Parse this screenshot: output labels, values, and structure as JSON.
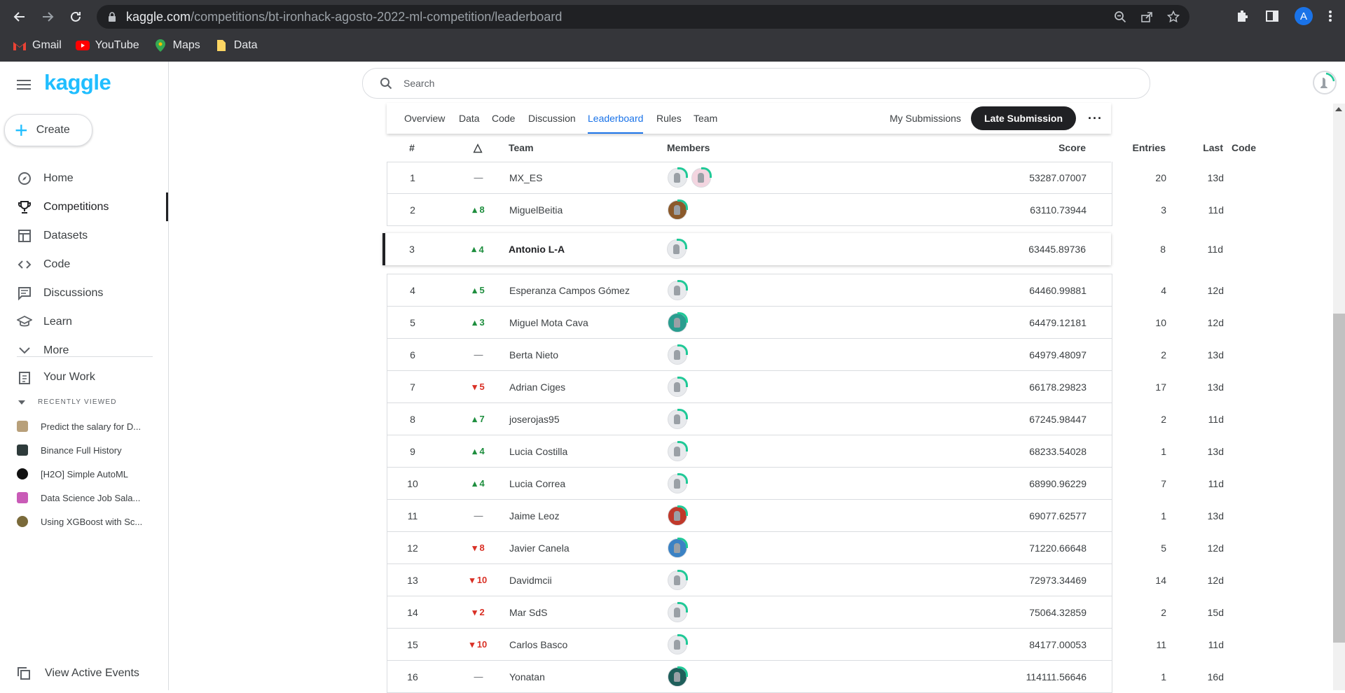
{
  "browser": {
    "url_domain": "kaggle.com",
    "url_path": "/competitions/bt-ironhack-agosto-2022-ml-competition/leaderboard",
    "profile_initial": "A",
    "bookmarks": [
      {
        "label": "Gmail",
        "icon": "gmail-icon"
      },
      {
        "label": "YouTube",
        "icon": "youtube-icon"
      },
      {
        "label": "Maps",
        "icon": "maps-icon"
      },
      {
        "label": "Data",
        "icon": "folder-icon"
      }
    ]
  },
  "sidebar": {
    "logo": "kaggle",
    "create_label": "Create",
    "items": [
      {
        "label": "Home",
        "icon": "compass-icon"
      },
      {
        "label": "Competitions",
        "icon": "trophy-icon",
        "active": true
      },
      {
        "label": "Datasets",
        "icon": "table-icon"
      },
      {
        "label": "Code",
        "icon": "code-icon"
      },
      {
        "label": "Discussions",
        "icon": "comment-icon"
      },
      {
        "label": "Learn",
        "icon": "school-icon"
      },
      {
        "label": "More",
        "icon": "chevron-down-icon"
      }
    ],
    "your_work": "Your Work",
    "recently_viewed_header": "RECENTLY VIEWED",
    "recent": [
      {
        "label": "Predict the salary for D..."
      },
      {
        "label": "Binance Full History"
      },
      {
        "label": "[H2O] Simple AutoML"
      },
      {
        "label": "Data Science Job Sala..."
      },
      {
        "label": "Using XGBoost with Sc..."
      }
    ],
    "view_active_events": "View Active Events"
  },
  "search": {
    "placeholder": "Search"
  },
  "tabs": {
    "items": [
      "Overview",
      "Data",
      "Code",
      "Discussion",
      "Leaderboard",
      "Rules",
      "Team"
    ],
    "active": "Leaderboard",
    "my_submissions": "My Submissions",
    "late_submission": "Late Submission",
    "more": "···"
  },
  "leaderboard": {
    "headers": {
      "rank": "#",
      "delta": "△",
      "team": "Team",
      "members": "Members",
      "score": "Score",
      "entries": "Entries",
      "last": "Last",
      "code": "Code"
    },
    "rows": [
      {
        "rank": "1",
        "delta": "—",
        "dir": "neutral",
        "team": "MX_ES",
        "score": "53287.07007",
        "entries": "20",
        "last": "13d"
      },
      {
        "rank": "2",
        "delta": "8",
        "dir": "up",
        "team": "MiguelBeitia",
        "score": "63110.73944",
        "entries": "3",
        "last": "11d"
      },
      {
        "rank": "3",
        "delta": "4",
        "dir": "up",
        "team": "Antonio L-A",
        "score": "63445.89736",
        "entries": "8",
        "last": "11d"
      },
      {
        "rank": "4",
        "delta": "5",
        "dir": "up",
        "team": "Esperanza Campos Gómez",
        "score": "64460.99881",
        "entries": "4",
        "last": "12d"
      },
      {
        "rank": "5",
        "delta": "3",
        "dir": "up",
        "team": "Miguel Mota Cava",
        "score": "64479.12181",
        "entries": "10",
        "last": "12d"
      },
      {
        "rank": "6",
        "delta": "—",
        "dir": "neutral",
        "team": "Berta Nieto",
        "score": "64979.48097",
        "entries": "2",
        "last": "13d"
      },
      {
        "rank": "7",
        "delta": "5",
        "dir": "down",
        "team": "Adrian Ciges",
        "score": "66178.29823",
        "entries": "17",
        "last": "13d"
      },
      {
        "rank": "8",
        "delta": "7",
        "dir": "up",
        "team": "joserojas95",
        "score": "67245.98447",
        "entries": "2",
        "last": "11d"
      },
      {
        "rank": "9",
        "delta": "4",
        "dir": "up",
        "team": "Lucia Costilla",
        "score": "68233.54028",
        "entries": "1",
        "last": "13d"
      },
      {
        "rank": "10",
        "delta": "4",
        "dir": "up",
        "team": "Lucia Correa",
        "score": "68990.96229",
        "entries": "7",
        "last": "11d"
      },
      {
        "rank": "11",
        "delta": "—",
        "dir": "neutral",
        "team": "Jaime Leoz",
        "score": "69077.62577",
        "entries": "1",
        "last": "13d"
      },
      {
        "rank": "12",
        "delta": "8",
        "dir": "down",
        "team": "Javier Canela",
        "score": "71220.66648",
        "entries": "5",
        "last": "12d"
      },
      {
        "rank": "13",
        "delta": "10",
        "dir": "down",
        "team": "Davidmcii",
        "score": "72973.34469",
        "entries": "14",
        "last": "12d"
      },
      {
        "rank": "14",
        "delta": "2",
        "dir": "down",
        "team": "Mar SdS",
        "score": "75064.32859",
        "entries": "2",
        "last": "15d"
      },
      {
        "rank": "15",
        "delta": "10",
        "dir": "down",
        "team": "Carlos Basco",
        "score": "84177.00053",
        "entries": "11",
        "last": "11d"
      },
      {
        "rank": "16",
        "delta": "—",
        "dir": "neutral",
        "team": "Yonatan",
        "score": "114111.56646",
        "entries": "1",
        "last": "16d"
      }
    ]
  },
  "colors": {
    "kaggle_blue": "#20beff",
    "up": "#1e8e3e",
    "down": "#d93025",
    "active_tab": "#1a73e8"
  }
}
